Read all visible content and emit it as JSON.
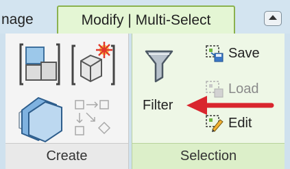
{
  "tabs": [
    {
      "label": "nage",
      "active": false
    },
    {
      "label": "Modify | Multi-Select",
      "active": true
    }
  ],
  "ribbon": {
    "create_panel": {
      "title": "Create"
    },
    "selection_panel": {
      "title": "Selection",
      "filter_label": "Filter",
      "save_label": "Save",
      "load_label": "Load",
      "edit_label": "Edit"
    }
  },
  "colors": {
    "active_tab_border": "#8ab14e",
    "arrow": "#d9262e"
  }
}
